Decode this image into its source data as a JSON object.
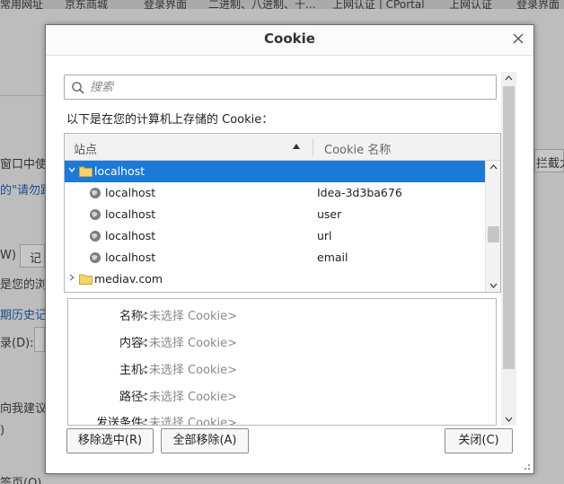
{
  "background": {
    "toolbar_items": [
      "常用网址",
      "京东商城",
      "登录界面",
      "二进制、八进制、十...",
      "上网认证 | CPortal",
      "上网认证",
      "登录界面"
    ],
    "snippets": [
      "窗口中使",
      "的\"请勿跟",
      "W)",
      "记",
      "是您的浏",
      "期历史记",
      "录(D):",
      "向我建议",
      ")",
      "签页(O)",
      "拦截太"
    ]
  },
  "dialog": {
    "title": "Cookie",
    "search_placeholder": "搜索",
    "caption": "以下是在您的计算机上存储的 Cookie：",
    "columns": {
      "site": "站点",
      "name": "Cookie 名称"
    },
    "rows": [
      {
        "type": "folder",
        "site": "localhost",
        "name": "",
        "expanded": true,
        "selected": true
      },
      {
        "type": "cookie",
        "site": "localhost",
        "name": "Idea-3d3ba676"
      },
      {
        "type": "cookie",
        "site": "localhost",
        "name": "user"
      },
      {
        "type": "cookie",
        "site": "localhost",
        "name": "url"
      },
      {
        "type": "cookie",
        "site": "localhost",
        "name": "email"
      },
      {
        "type": "folder",
        "site": "mediav.com",
        "name": "",
        "expanded": false,
        "selected": false
      }
    ],
    "details": [
      {
        "label": "名称：",
        "value": "<未选择 Cookie>"
      },
      {
        "label": "内容：",
        "value": "<未选择 Cookie>"
      },
      {
        "label": "主机：",
        "value": "<未选择 Cookie>"
      },
      {
        "label": "路径：",
        "value": "<未选择 Cookie>"
      },
      {
        "label": "发送条件：",
        "value": "<未选择 Cookie>"
      }
    ],
    "buttons": {
      "remove_selected": "移除选中(R)",
      "remove_all": "全部移除(A)",
      "close": "关闭(C)"
    }
  },
  "colors": {
    "selection": "#1c79d6",
    "folder": "#f3d36b",
    "overlay": "#bdbdbd"
  }
}
